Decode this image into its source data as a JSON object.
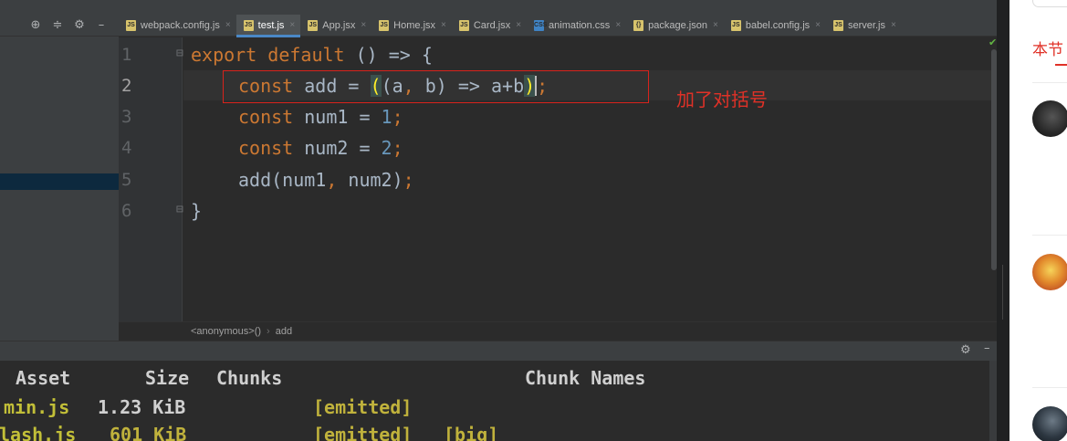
{
  "toolbar": {
    "icons": [
      "crosshair-icon",
      "collapse-icon",
      "gear-icon",
      "minimize-icon"
    ]
  },
  "tabs": [
    {
      "label": "webpack.config.js",
      "icon": "js-file-icon",
      "icon_color": "#d7c36c",
      "active": false
    },
    {
      "label": "test.js",
      "icon": "js-file-icon",
      "icon_color": "#d7c36c",
      "active": true
    },
    {
      "label": "App.jsx",
      "icon": "jsx-file-icon",
      "icon_color": "#d7c36c",
      "active": false
    },
    {
      "label": "Home.jsx",
      "icon": "jsx-file-icon",
      "icon_color": "#d7c36c",
      "active": false
    },
    {
      "label": "Card.jsx",
      "icon": "jsx-file-icon",
      "icon_color": "#d7c36c",
      "active": false
    },
    {
      "label": "animation.css",
      "icon": "css-file-icon",
      "icon_color": "#3f83c4",
      "active": false
    },
    {
      "label": "package.json",
      "icon": "json-file-icon",
      "icon_color": "#d7c36c",
      "active": false
    },
    {
      "label": "babel.config.js",
      "icon": "js-file-icon",
      "icon_color": "#d7c36c",
      "active": false
    },
    {
      "label": "server.js",
      "icon": "js-file-icon",
      "icon_color": "#d7c36c",
      "active": false
    }
  ],
  "editor": {
    "line_numbers": [
      "1",
      "2",
      "3",
      "4",
      "5",
      "6"
    ],
    "lines": {
      "l1": {
        "kw1": "export",
        "kw2": "default",
        "rest": " () => {"
      },
      "l2": {
        "kw": "const",
        "a": " add = ",
        "open": "(",
        "b": "(a",
        "comma": ",",
        "c": " b) => a+b",
        "close": ")",
        "semi": ";"
      },
      "l3": {
        "kw": "const",
        "a": " num1 = ",
        "num": "1",
        "semi": ";"
      },
      "l4": {
        "kw": "const",
        "a": " num2 = ",
        "num": "2",
        "semi": ";"
      },
      "l5": {
        "a": "add(num1",
        "comma": ",",
        "b": " num2)",
        "semi": ";"
      },
      "l6": {
        "a": "}"
      }
    },
    "annotation": "加了对括号"
  },
  "breadcrumbs": [
    "<anonymous>()",
    "add"
  ],
  "terminal": {
    "headers": {
      "asset": "Asset",
      "size": "Size",
      "chunks": "Chunks",
      "chunk_names": "Chunk Names"
    },
    "rows": [
      {
        "asset": "min.js",
        "size": "1.23 KiB",
        "status": "[emitted]",
        "flag": ""
      },
      {
        "asset": "lash.js",
        "size": "601 KiB",
        "status": "[emitted]",
        "flag": "[big]"
      }
    ]
  },
  "web": {
    "tab_label": "本节"
  },
  "colors": {
    "keyword": "#cc7832",
    "number": "#6897bb",
    "text": "#a9b7c6",
    "annotation_red": "#e03127",
    "active_tab_underline": "#4a88c7"
  }
}
